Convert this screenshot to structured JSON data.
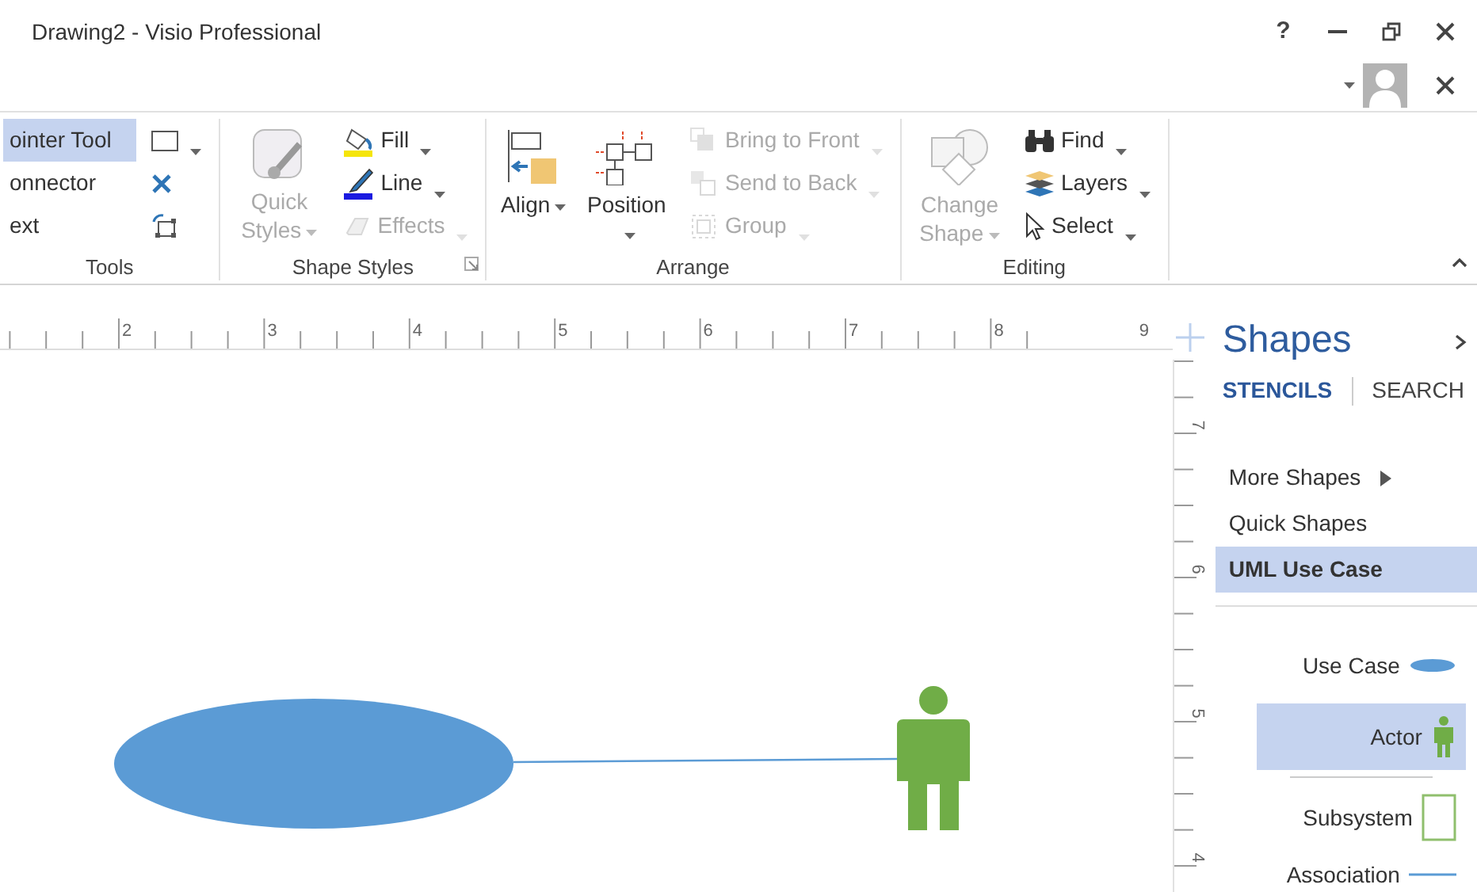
{
  "window": {
    "title": "Drawing2 - Visio Professional",
    "help": "?"
  },
  "ribbon": {
    "groups": [
      {
        "label": "Tools",
        "launcher": false,
        "columns": [
          [
            {
              "kind": "small",
              "label": "ointer Tool",
              "selected": true,
              "disabled": false,
              "dropdown": false
            },
            {
              "kind": "small",
              "label": "onnector",
              "selected": false,
              "disabled": false,
              "dropdown": false
            },
            {
              "kind": "small",
              "label": "ext",
              "selected": false,
              "disabled": false,
              "dropdown": false
            }
          ],
          [
            {
              "kind": "icon",
              "disabled": false,
              "dropdown": true
            },
            {
              "kind": "icon",
              "disabled": false,
              "dropdown": false
            },
            {
              "kind": "icon",
              "disabled": false,
              "dropdown": false
            }
          ]
        ]
      },
      {
        "label": "Shape Styles",
        "launcher": true,
        "columns": [
          [
            {
              "kind": "large",
              "label": "Quick Styles",
              "disabled": true,
              "dropdown": true
            }
          ],
          [
            {
              "kind": "small",
              "label": "Fill",
              "disabled": false,
              "dropdown": true
            },
            {
              "kind": "small",
              "label": "Line",
              "disabled": false,
              "dropdown": true
            },
            {
              "kind": "small",
              "label": "Effects",
              "disabled": true,
              "dropdown": true
            }
          ]
        ]
      },
      {
        "label": "Arrange",
        "launcher": false,
        "columns": [
          [
            {
              "kind": "large",
              "label": "Align",
              "disabled": false,
              "dropdown": true
            }
          ],
          [
            {
              "kind": "large",
              "label": "Position",
              "disabled": false,
              "dropdown": true
            }
          ],
          [
            {
              "kind": "small",
              "label": "Bring to Front",
              "disabled": true,
              "dropdown": true
            },
            {
              "kind": "small",
              "label": "Send to Back",
              "disabled": true,
              "dropdown": true
            },
            {
              "kind": "small",
              "label": "Group",
              "disabled": true,
              "dropdown": true
            }
          ]
        ]
      },
      {
        "label": "Editing",
        "launcher": false,
        "columns": [
          [
            {
              "kind": "large",
              "label": "Change Shape",
              "disabled": true,
              "dropdown": true
            }
          ],
          [
            {
              "kind": "small",
              "label": "Find",
              "disabled": false,
              "dropdown": true
            },
            {
              "kind": "small",
              "label": "Layers",
              "disabled": false,
              "dropdown": true
            },
            {
              "kind": "small",
              "label": "Select",
              "disabled": false,
              "dropdown": true
            }
          ]
        ]
      }
    ]
  },
  "ruler": {
    "horizontal": [
      "2",
      "3",
      "4",
      "5",
      "6",
      "7",
      "8",
      "9"
    ],
    "vertical": [
      "7",
      "6",
      "5",
      "4"
    ]
  },
  "shapes_pane": {
    "title": "Shapes",
    "tabs": [
      {
        "label": "STENCILS",
        "selected": true
      },
      {
        "label": "SEARCH",
        "selected": false
      }
    ],
    "stencils": [
      {
        "label": "More Shapes",
        "selected": false,
        "submenu": true
      },
      {
        "label": "Quick Shapes",
        "selected": false,
        "submenu": false
      },
      {
        "label": "UML Use Case",
        "selected": true,
        "submenu": false
      }
    ],
    "masters": [
      {
        "label": "Use Case",
        "selected": false
      },
      {
        "label": "Actor",
        "selected": true
      },
      {
        "label": "Subsystem",
        "selected": false
      },
      {
        "label": "Association",
        "selected": false
      }
    ]
  }
}
